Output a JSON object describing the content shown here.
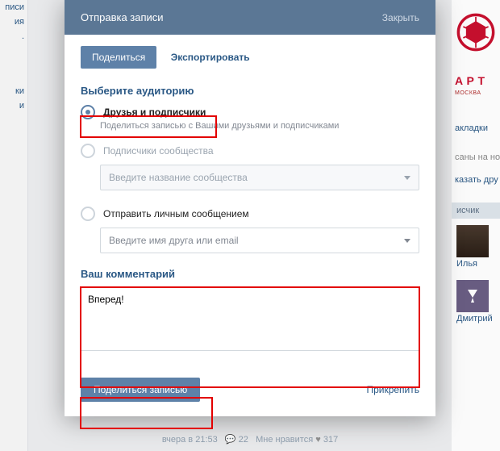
{
  "modal": {
    "title": "Отправка записи",
    "close": "Закрыть",
    "tabs": {
      "share": "Поделиться",
      "export": "Экспортировать"
    }
  },
  "audience": {
    "heading": "Выберите аудиторию",
    "opt1_label": "Друзья и подписчики",
    "opt1_hint": "Поделиться записью с Вашими друзьями и подписчиками",
    "opt2_label": "Подписчики сообщества",
    "opt2_placeholder": "Введите название сообщества",
    "opt3_label": "Отправить личным сообщением",
    "opt3_placeholder": "Введите имя друга или email"
  },
  "comment_block": {
    "heading": "Ваш комментарий",
    "value": "Вперед!"
  },
  "footer": {
    "submit": "Поделиться записью",
    "attach": "Прикрепить"
  },
  "bg": {
    "left": [
      "писи",
      "ия",
      ".",
      "ки",
      "и"
    ],
    "brand": "A P T",
    "brand_sub": "МОСКВА",
    "link1": "акладки",
    "link2": "саны на но",
    "link3": "казать дру",
    "head": "исчик",
    "av1": "Илья",
    "av2": "Дмитрий",
    "foot_time": "вчера в 21:53",
    "foot_comments": "22",
    "foot_likes": "Мне нравится",
    "foot_count": "317"
  }
}
